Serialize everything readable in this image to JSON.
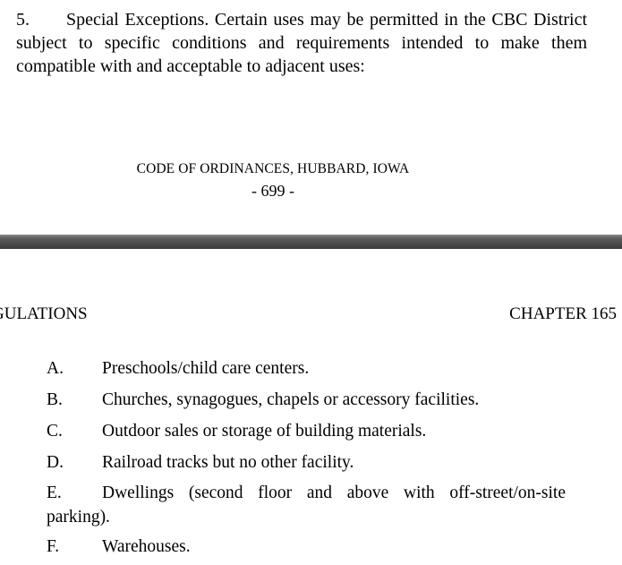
{
  "top_page": {
    "section_number": "5.",
    "section_text": "Special Exceptions.  Certain uses may be permitted in the CBC District subject to specific conditions and requirements intended to make them compatible with and acceptable to adjacent uses:",
    "footer_title": "CODE OF ORDINANCES, HUBBARD, IOWA",
    "footer_page": "- 699 -"
  },
  "bottom_page": {
    "header_left": "GULATIONS",
    "header_right": "CHAPTER 165",
    "items": [
      {
        "letter": "A.",
        "text": "Preschools/child care centers."
      },
      {
        "letter": "B.",
        "text": "Churches, synagogues, chapels or accessory facilities."
      },
      {
        "letter": "C.",
        "text": "Outdoor sales or storage of building materials."
      },
      {
        "letter": "D.",
        "text": "Railroad tracks but no other facility."
      },
      {
        "letter": "E.",
        "line1": "Dwellings (second floor and above with off-street/on-site",
        "line2": "parking)."
      },
      {
        "letter": "F.",
        "text": "Warehouses."
      }
    ]
  }
}
